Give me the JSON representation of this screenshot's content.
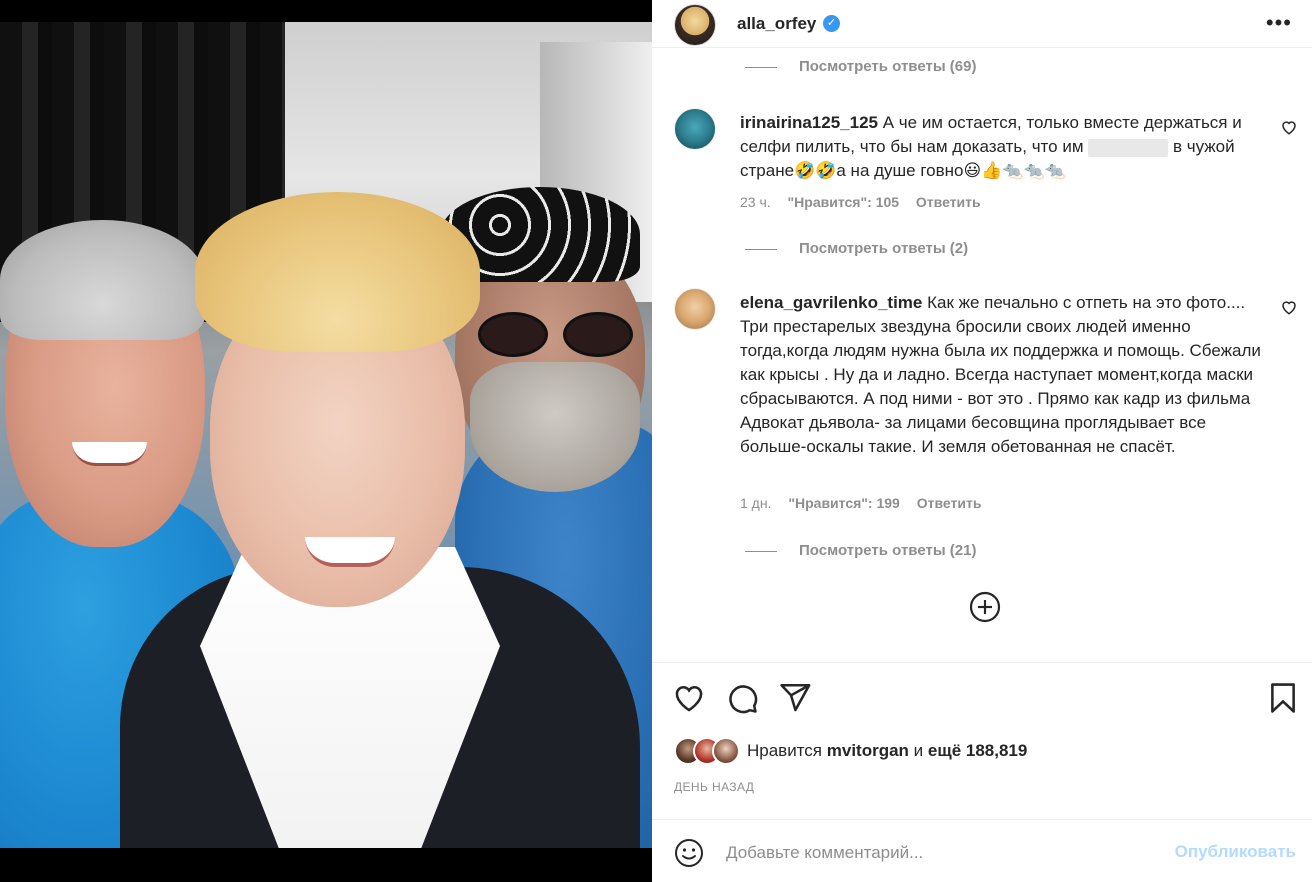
{
  "post": {
    "author": "alla_orfey",
    "verified_mark": "✓",
    "more_icon": "more-options-icon"
  },
  "comments": {
    "top_replies": "Посмотреть ответы (69)",
    "items": [
      {
        "username": "irinairina125_125",
        "text_before": "А че им остается, только вместе держаться и селфи пилить, что бы нам доказать, что им",
        "text_after": "в чужой стране🤣🤣а на душе говно😃👍🐀🐀🐀",
        "time": "23 ч.",
        "likes": "\"Нравится\": 105",
        "reply": "Ответить",
        "view_replies": "Посмотреть ответы (2)"
      },
      {
        "username": "elena_gavrilenko_time",
        "text": "Как же печально с отпеть на это фото.... Три престарелых звездуна бросили своих людей именно тогда,когда людям нужна была их поддержка и помощь. Сбежали как крысы . Ну да и ладно. Всегда наступает момент,когда маски сбрасываются. А под ними - вот это . Прямо как кадр из фильма Адвокат дьявола- за лицами бесовщина проглядывает все больше-оскалы такие. И земля обетованная не спасёт.",
        "time": "1 дн.",
        "likes": "\"Нравится\": 199",
        "reply": "Ответить",
        "view_replies": "Посмотреть ответы (21)"
      }
    ]
  },
  "actions": {
    "liked_by_prefix": "Нравится",
    "liked_by_user": "mvitorgan",
    "liked_by_and": "и",
    "liked_by_count": "ещё 188,819",
    "time_ago": "ДЕНЬ НАЗАД"
  },
  "comment_box": {
    "placeholder": "Добавьте комментарий...",
    "publish_label": "Опубликовать"
  },
  "colors": {
    "accent": "#0095f6",
    "publish_disabled": "#b3dbff",
    "secondary_text": "#8e8e8e",
    "verified": "#3897f0"
  }
}
